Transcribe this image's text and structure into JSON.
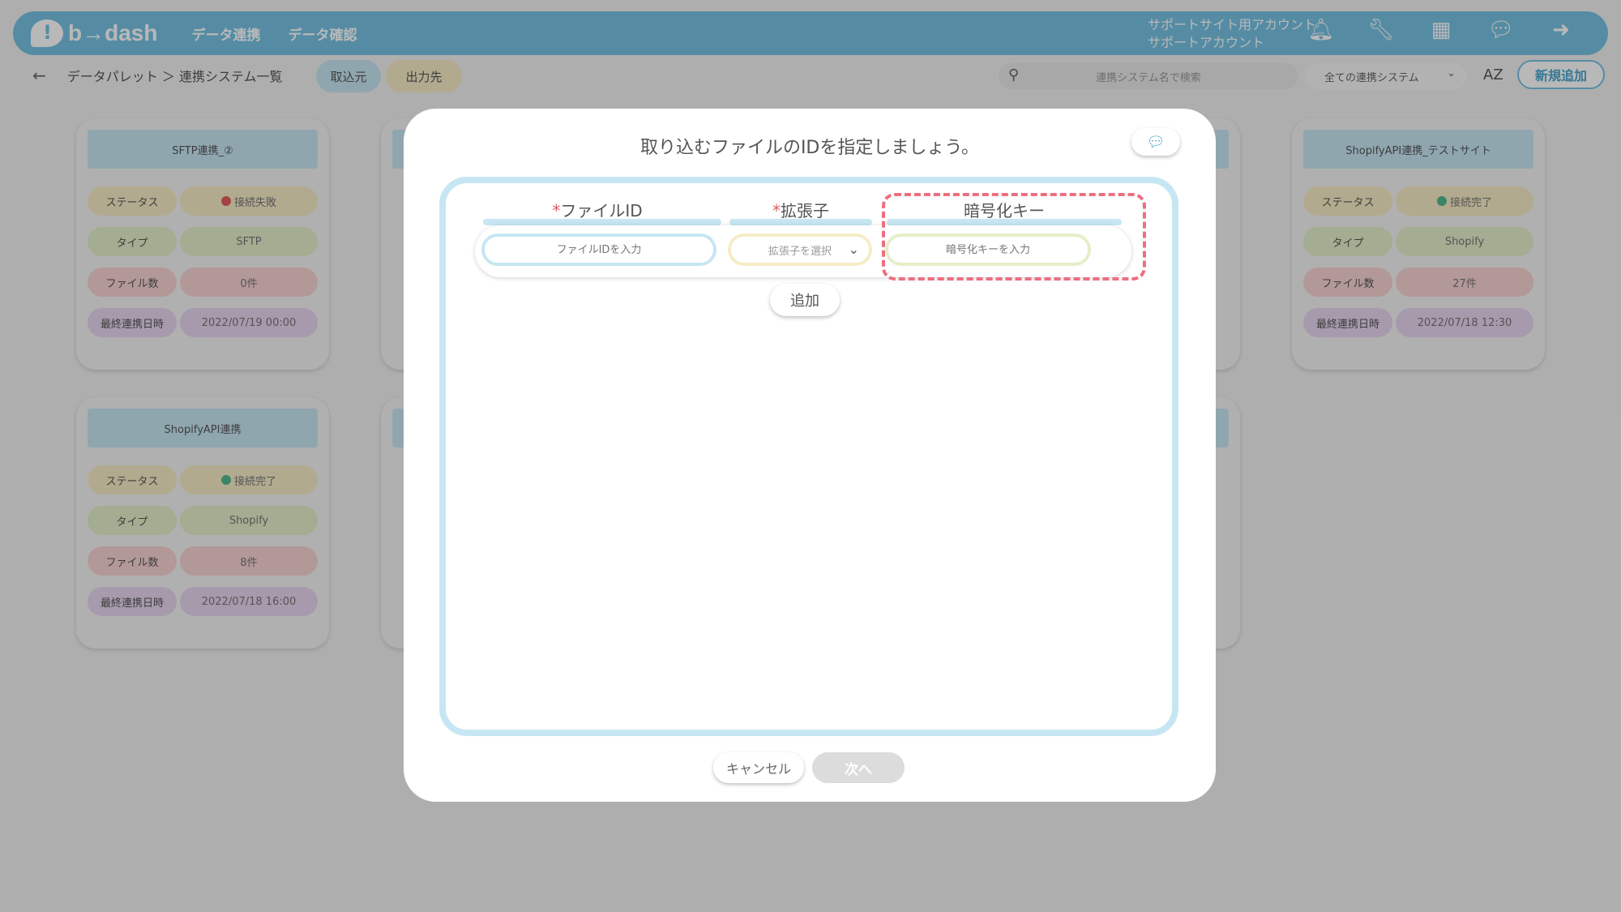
{
  "app": {
    "logo_text": "b→dash"
  },
  "topnav": [
    "データ連携",
    "データ確認"
  ],
  "account": {
    "line1": "サポートサイト用アカウント",
    "line2": "サポートアカウント"
  },
  "topicons": [
    "bell-icon",
    "wrench-icon",
    "grid-icon",
    "chat-icon",
    "logout-icon"
  ],
  "subbar": {
    "breadcrumb": "データパレット ＞ 連携システム一覧",
    "tab_import": "取込元",
    "tab_export": "出力先",
    "search_placeholder": "連携システム名で検索",
    "filter_value": "全ての連携システム",
    "sort_label": "AZ",
    "new_button": "新規追加"
  },
  "cards": [
    {
      "title": "SFTP連携_②",
      "status": "接続失敗",
      "status_color": "#e25c5c",
      "type": "SFTP",
      "files": "0件",
      "last_sync": "2022/07/19 00:00"
    },
    {
      "title": "ShopifyAPI連携_テストサイト",
      "status": "接続完了",
      "status_color": "#4fb98e",
      "type": "Shopify",
      "files": "27件",
      "last_sync": "2022/07/18 12:30"
    },
    {
      "title": "ShopifyAPI連携",
      "status": "接続完了",
      "status_color": "#4fb98e",
      "type": "Shopify",
      "files": "8件",
      "last_sync": "2022/07/18 16:00"
    }
  ],
  "row_labels": {
    "status": "ステータス",
    "type": "タイプ",
    "files": "ファイル数",
    "last_sync": "最終連携日時"
  },
  "modal": {
    "title": "取り込むファイルのIDを指定しましょう。",
    "col_file_id": "ファイルID",
    "col_ext": "拡張子",
    "col_key": "暗号化キー",
    "required_mark": "*",
    "file_id_placeholder": "ファイルIDを入力",
    "ext_placeholder": "拡張子を選択",
    "key_placeholder": "暗号化キーを入力",
    "add_button": "追加",
    "cancel_button": "キャンセル",
    "next_button": "次へ"
  },
  "colors": {
    "accent": "#76c3e4",
    "highlight": "#ec6f80",
    "required": "#e25c5c"
  }
}
